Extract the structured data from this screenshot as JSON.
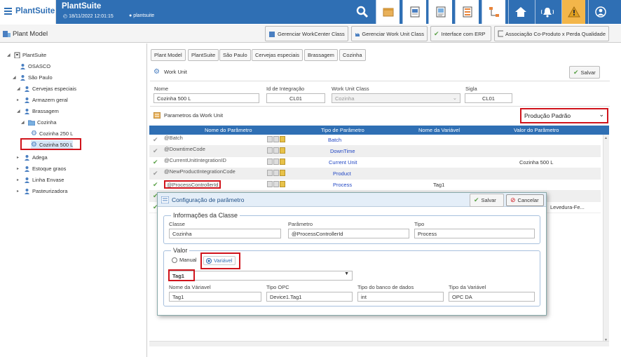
{
  "app": {
    "logo": "PlantSuite",
    "title": "PlantSuite",
    "datetime": "18/11/2022 12:01:15",
    "user": "plantsuite"
  },
  "toolbar_icons": [
    "search-icon",
    "box-icon",
    "document-chart-icon",
    "document-grid-icon",
    "list-icon",
    "flow-icon",
    "home-icon",
    "alarm-icon",
    "warning-icon",
    "user-icon"
  ],
  "header": {
    "title": "Plant Model",
    "buttons": [
      "Gerenciar WorkCenter Class",
      "Gerenciar Work Unit Class",
      "Interface com ERP",
      "Associação Co-Produto x Perda Qualidade"
    ]
  },
  "tree": [
    {
      "label": "PlantSuite",
      "icon": "building-icon",
      "expanded": true
    },
    {
      "label": "OSASCO",
      "icon": "people-icon"
    },
    {
      "label": "São Paulo",
      "icon": "people-icon",
      "expanded": true
    },
    {
      "label": "Cervejas especiais",
      "icon": "people-icon",
      "expanded": true
    },
    {
      "label": "Armazem geral",
      "icon": "people-icon"
    },
    {
      "label": "Brassagem",
      "icon": "people-icon",
      "expanded": true
    },
    {
      "label": "Cozinha",
      "icon": "folder-icon",
      "expanded": true
    },
    {
      "label": "Cozinha 250 L",
      "icon": "gear-icon"
    },
    {
      "label": "Cozinha 500 L",
      "icon": "gear-icon",
      "selected": true
    },
    {
      "label": "Adega",
      "icon": "people-icon"
    },
    {
      "label": "Estoque graos",
      "icon": "people-icon"
    },
    {
      "label": "Linha Envase",
      "icon": "people-icon"
    },
    {
      "label": "Pasteurizadora",
      "icon": "people-icon"
    }
  ],
  "breadcrumb": [
    "Plant Model",
    "PlantSuite",
    "São Paulo",
    "Cervejas especiais",
    "Brassagem",
    "Cozinha"
  ],
  "workunit": {
    "section_title": "Work Unit",
    "save_label": "Salvar",
    "fields": {
      "name_label": "Nome",
      "name_value": "Cozinha 500 L",
      "id_label": "Id de Integração",
      "id_value": "CL01",
      "class_label": "Work Unit Class",
      "class_value": "Cozinha",
      "sigla_label": "Sigla",
      "sigla_value": "CL01"
    }
  },
  "params": {
    "section_title": "Parametros da Work Unit",
    "dropdown_value": "Produção Padrão",
    "columns": [
      "Nome do Parâmetro",
      "Tipo de Parâmetro",
      "Nome da Variável",
      "Valor do Parâmetro"
    ],
    "rows": [
      {
        "name": "@Batch",
        "type": "Batch",
        "variable": "",
        "value": "",
        "checked": false
      },
      {
        "name": "@DowntimeCode",
        "type": "DownTime",
        "variable": "",
        "value": "",
        "checked": false
      },
      {
        "name": "@CurrentUnitIntegrationID",
        "type": "Current Unit",
        "variable": "",
        "value": "Cozinha 500 L",
        "checked": true
      },
      {
        "name": "@NewProductIntegrationCode",
        "type": "Product",
        "variable": "",
        "value": "",
        "checked": false
      },
      {
        "name": "@ProcessControllerId",
        "type": "Process",
        "variable": "Tag1",
        "value": "",
        "checked": true
      },
      {
        "name": "",
        "type": "",
        "variable": "",
        "value": "",
        "checked": true
      },
      {
        "name": "",
        "type": "",
        "variable": "",
        "value": "Levedura-Fe...",
        "checked": true
      }
    ]
  },
  "dialog": {
    "title": "Configuração de parâmetro",
    "save_label": "Salvar",
    "cancel_label": "Cancelar",
    "class_section": "Informações da Classe",
    "class_fields": {
      "classe_label": "Classe",
      "classe_value": "Cozinha",
      "param_label": "Parâmetro",
      "param_value": "@ProcessControllerId",
      "tipo_label": "Tipo",
      "tipo_value": "Process"
    },
    "value_section": "Valor",
    "radio_manual": "Manual",
    "radio_variavel": "Variável",
    "selected_radio": "Variável",
    "variable_select": "Tag1",
    "var_fields": {
      "nome_label": "Nome da Váriavel",
      "nome_value": "Tag1",
      "opc_label": "Tipo OPC",
      "opc_value": "Device1.Tag1",
      "db_label": "Tipo do banco de dados",
      "db_value": "int",
      "var_label": "Tipo da Variável",
      "var_value": "OPC DA"
    }
  },
  "colors": {
    "primary": "#2f6fb4",
    "highlight": "#d0141c",
    "warning": "#f3b64a",
    "check": "#5ca24a"
  }
}
